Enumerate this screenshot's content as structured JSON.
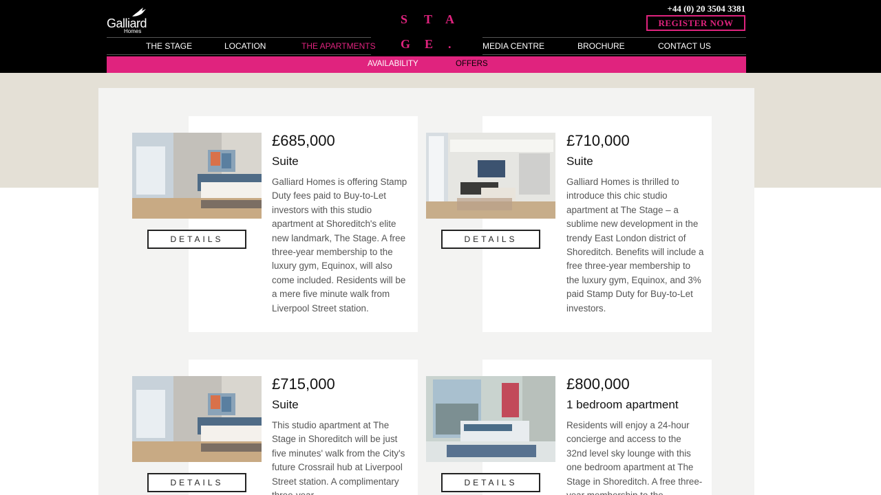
{
  "header": {
    "logo_brand": "Galliard",
    "logo_sub": "Homes",
    "phone": "+44 (0) 20 3504 3381",
    "register_label": "REGISTER NOW",
    "stage_letters": [
      "S",
      "T",
      "A",
      "G",
      "E",
      "."
    ],
    "nav": [
      "THE STAGE",
      "LOCATION",
      "THE APARTMENTS",
      "MEDIA CENTRE",
      "BROCHURE",
      "CONTACT US"
    ],
    "subnav": [
      "AVAILABILITY",
      "OFFERS"
    ]
  },
  "colors": {
    "accent": "#e0237e",
    "header_bg": "#000000",
    "band_bg": "#e4e0d6"
  },
  "listings": [
    {
      "price": "£685,000",
      "type": "Suite",
      "description": "Galliard Homes is offering Stamp Duty fees paid to Buy-to-Let investors with this studio apartment at Shoreditch's elite new landmark, The Stage. A free three-year membership to the luxury gym, Equinox, will also come included. Residents will be a mere five minute walk from Liverpool Street station.",
      "button": "DETAILS"
    },
    {
      "price": "£710,000",
      "type": "Suite",
      "description": "Galliard Homes is thrilled to introduce this chic studio apartment at The Stage – a sublime new development in the trendy East London district of Shoreditch. Benefits will include a free three-year membership to the luxury gym, Equinox, and 3% paid Stamp Duty for Buy-to-Let investors.",
      "button": "DETAILS"
    },
    {
      "price": "£715,000",
      "type": "Suite",
      "description": "This studio apartment at The Stage in Shoreditch will be just five minutes' walk from the City's future Crossrail hub at Liverpool Street station. A complimentary three-year",
      "button": "DETAILS"
    },
    {
      "price": "£800,000",
      "type": "1 bedroom apartment",
      "description": "Residents will enjoy a 24-hour concierge and access to the 32nd level sky lounge with this one bedroom apartment at The Stage in Shoreditch. A free three-year membership to the",
      "button": "DETAILS"
    }
  ]
}
